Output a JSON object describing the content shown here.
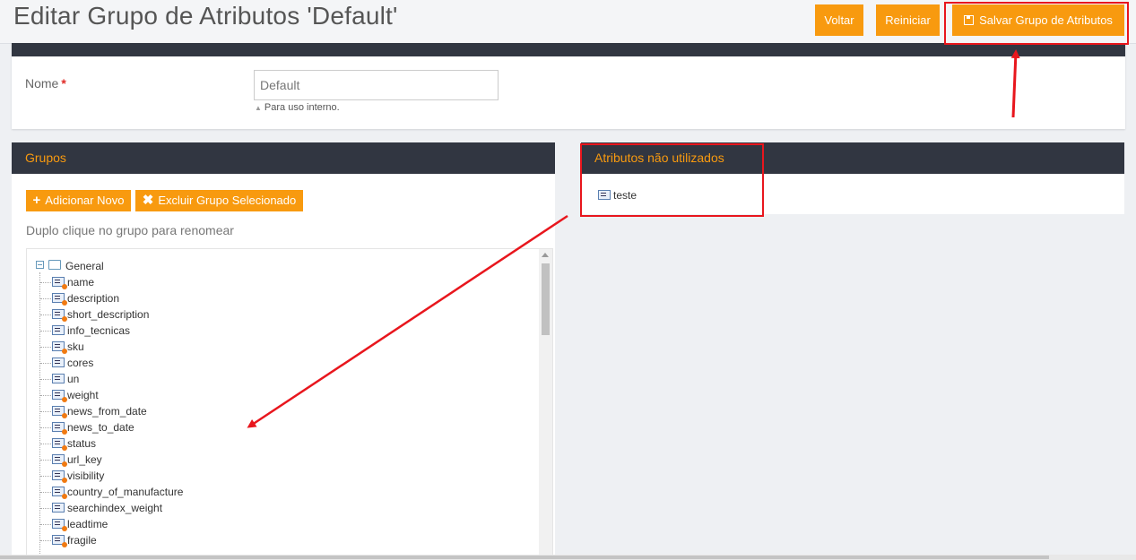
{
  "header": {
    "title": "Editar Grupo de Atributos 'Default'",
    "back_label": "Voltar",
    "reset_label": "Reiniciar",
    "save_label": "Salvar Grupo de Atributos",
    "save_icon": "floppy-disk-icon"
  },
  "form": {
    "name_label": "Nome",
    "required_mark": "*",
    "name_value": "Default",
    "name_note": "Para uso interno."
  },
  "groups_panel": {
    "title": "Grupos",
    "add_label": "Adicionar Novo",
    "delete_label": "Excluir Grupo Selecionado",
    "hint": "Duplo clique no grupo para renomear",
    "root_label": "General",
    "items": [
      {
        "label": "name",
        "user_defined": false
      },
      {
        "label": "description",
        "user_defined": false
      },
      {
        "label": "short_description",
        "user_defined": false
      },
      {
        "label": "info_tecnicas",
        "user_defined": true
      },
      {
        "label": "sku",
        "user_defined": false
      },
      {
        "label": "cores",
        "user_defined": true
      },
      {
        "label": "un",
        "user_defined": true
      },
      {
        "label": "weight",
        "user_defined": false
      },
      {
        "label": "news_from_date",
        "user_defined": false
      },
      {
        "label": "news_to_date",
        "user_defined": false
      },
      {
        "label": "status",
        "user_defined": false
      },
      {
        "label": "url_key",
        "user_defined": false
      },
      {
        "label": "visibility",
        "user_defined": false
      },
      {
        "label": "country_of_manufacture",
        "user_defined": false
      },
      {
        "label": "searchindex_weight",
        "user_defined": true
      },
      {
        "label": "leadtime",
        "user_defined": false
      },
      {
        "label": "fragile",
        "user_defined": false
      }
    ]
  },
  "unused_panel": {
    "title": "Atributos não utilizados",
    "items": [
      {
        "label": "teste"
      }
    ]
  },
  "colors": {
    "accent": "#f89a0f",
    "panel_header": "#313641",
    "highlight": "#e8161d"
  }
}
